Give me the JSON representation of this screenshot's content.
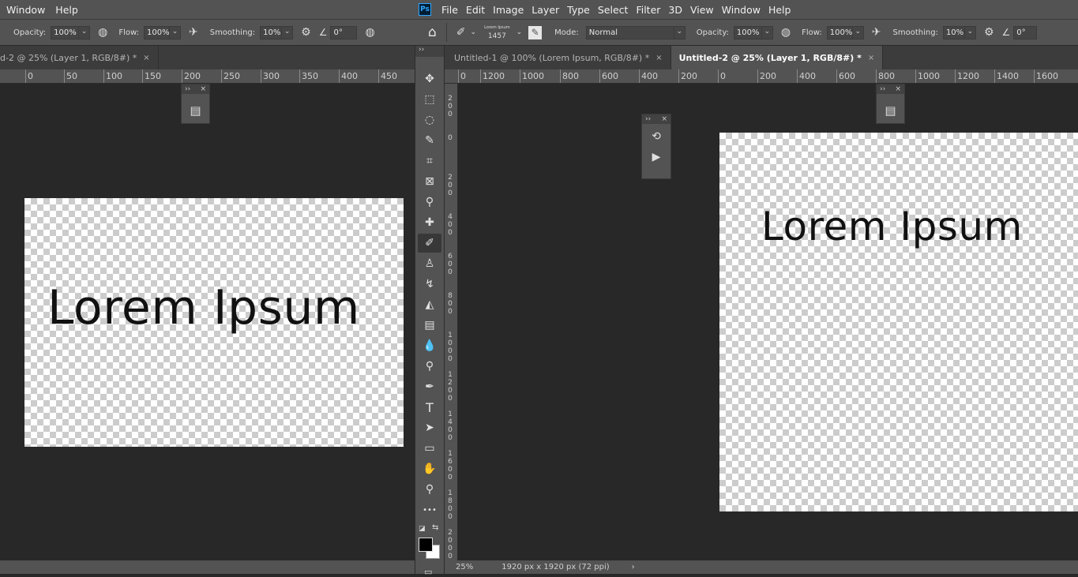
{
  "left_window": {
    "menu": [
      "Window",
      "Help"
    ],
    "options": {
      "opacity_label": "Opacity:",
      "opacity_value": "100%",
      "flow_label": "Flow:",
      "flow_value": "100%",
      "smoothing_label": "Smoothing:",
      "smoothing_value": "10%",
      "angle_value": "0°"
    },
    "tab": {
      "label": "d-2 @ 25% (Layer 1, RGB/8#) *",
      "close": "×"
    },
    "ruler_labels": [
      "0",
      "50",
      "100",
      "150",
      "200",
      "250",
      "300",
      "350",
      "400",
      "450"
    ],
    "canvas_text": "Lorem Ipsum",
    "mini_panel_close": "×",
    "mini_panel_collapse": "››"
  },
  "right_window": {
    "app_icon": "Ps",
    "menu": [
      "File",
      "Edit",
      "Image",
      "Layer",
      "Type",
      "Select",
      "Filter",
      "3D",
      "View",
      "Window",
      "Help"
    ],
    "options": {
      "brush_preset_name": "Lorem Ipsum",
      "brush_size": "1457",
      "mode_label": "Mode:",
      "mode_value": "Normal",
      "opacity_label": "Opacity:",
      "opacity_value": "100%",
      "flow_label": "Flow:",
      "flow_value": "100%",
      "smoothing_label": "Smoothing:",
      "smoothing_value": "10%",
      "angle_value": "0°"
    },
    "tabs": [
      {
        "label": "Untitled-1 @ 100% (Lorem Ipsum, RGB/8#) *",
        "close": "×",
        "active": false
      },
      {
        "label": "Untitled-2 @ 25% (Layer 1, RGB/8#) *",
        "close": "×",
        "active": true
      }
    ],
    "ruler_labels": [
      "0",
      "1200",
      "1000",
      "800",
      "600",
      "400",
      "200",
      "0",
      "200",
      "400",
      "600",
      "800",
      "1000",
      "1200",
      "1400",
      "1600"
    ],
    "vruler_labels": [
      "2 0 0",
      "0",
      "2 0 0",
      "4 0 0",
      "6 0 0",
      "8 0 0",
      "1 0 0 0",
      "1 2 0 0",
      "1 4 0 0",
      "1 6 0 0",
      "1 8 0 0",
      "2 0 0 0"
    ],
    "canvas_text": "Lorem Ipsum",
    "status": {
      "zoom": "25%",
      "doc_info": "1920 px x 1920 px (72 ppi)",
      "arrow": "›"
    },
    "actions_panel": {
      "collapse": "››",
      "close": "×"
    }
  },
  "toolbar": {
    "collapse": "››",
    "tools": [
      {
        "icon": "move-icon",
        "glyph": "✥"
      },
      {
        "icon": "marquee-icon",
        "glyph": "⬚"
      },
      {
        "icon": "lasso-icon",
        "glyph": "◌"
      },
      {
        "icon": "quick-select-icon",
        "glyph": "✎"
      },
      {
        "icon": "crop-icon",
        "glyph": "⌗"
      },
      {
        "icon": "frame-icon",
        "glyph": "⊠"
      },
      {
        "icon": "eyedropper-icon",
        "glyph": "⚲"
      },
      {
        "icon": "healing-brush-icon",
        "glyph": "✚"
      },
      {
        "icon": "brush-icon",
        "glyph": "✐"
      },
      {
        "icon": "clone-stamp-icon",
        "glyph": "♙"
      },
      {
        "icon": "history-brush-icon",
        "glyph": "↯"
      },
      {
        "icon": "eraser-icon",
        "glyph": "◭"
      },
      {
        "icon": "gradient-icon",
        "glyph": "▤"
      },
      {
        "icon": "blur-icon",
        "glyph": "💧"
      },
      {
        "icon": "dodge-icon",
        "glyph": "⚲"
      },
      {
        "icon": "pen-icon",
        "glyph": "✒"
      },
      {
        "icon": "type-icon",
        "glyph": "T"
      },
      {
        "icon": "path-select-icon",
        "glyph": "➤"
      },
      {
        "icon": "rectangle-icon",
        "glyph": "▭"
      },
      {
        "icon": "hand-icon",
        "glyph": "✋"
      },
      {
        "icon": "zoom-icon",
        "glyph": "⚲"
      },
      {
        "icon": "more-tools-icon",
        "glyph": "•••"
      }
    ],
    "selected_tool": "brush-icon",
    "foreground_color": "#000000",
    "background_color": "#ffffff"
  }
}
